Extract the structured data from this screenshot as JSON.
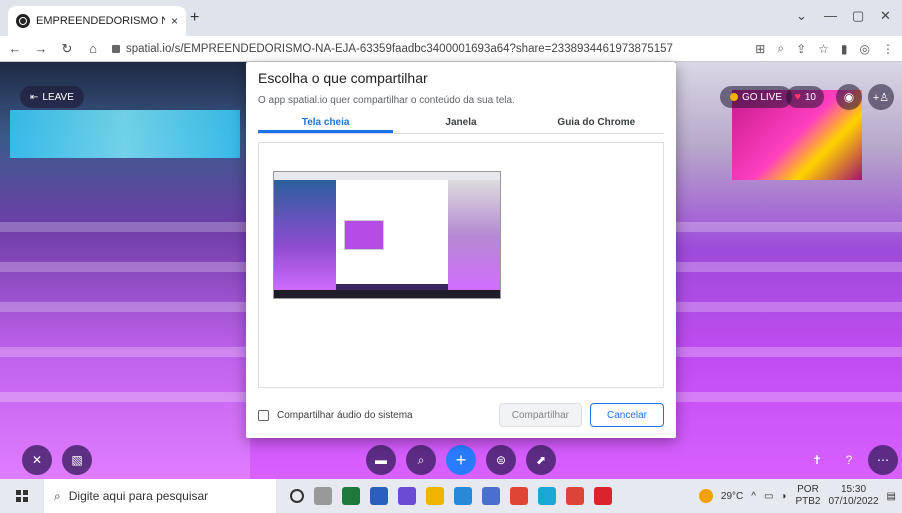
{
  "browser": {
    "tab_title": "EMPREENDEDORISMO NA EJA | ",
    "tab_close": "×",
    "new_tab": "+",
    "url": "spatial.io/s/EMPREENDEDORISMO-NA-EJA-63359faadbc3400001693a64?share=2338934461973875157",
    "window_controls": [
      "⌄",
      "—",
      "▢",
      "✕"
    ]
  },
  "space": {
    "leave_label": "LEAVE",
    "golive_label": "GO LIVE",
    "likes_count": "10"
  },
  "dialog": {
    "title": "Escolha o que compartilhar",
    "subtitle": "O app spatial.io quer compartilhar o conteúdo da sua tela.",
    "tabs": [
      {
        "label": "Tela cheia",
        "active": true
      },
      {
        "label": "Janela",
        "active": false
      },
      {
        "label": "Guia do Chrome",
        "active": false
      }
    ],
    "audio_checkbox_label": "Compartilhar áudio do sistema",
    "share_button": "Compartilhar",
    "cancel_button": "Cancelar"
  },
  "taskbar": {
    "search_placeholder": "Digite aqui para pesquisar",
    "weather": "29°C",
    "language": "POR",
    "language_sub": "PTB2",
    "time": "15:30",
    "date": "07/10/2022"
  },
  "colors": {
    "accent": "#1a73e8",
    "scene_purple": "#c04cf0",
    "action_blue": "#2b7bff"
  }
}
